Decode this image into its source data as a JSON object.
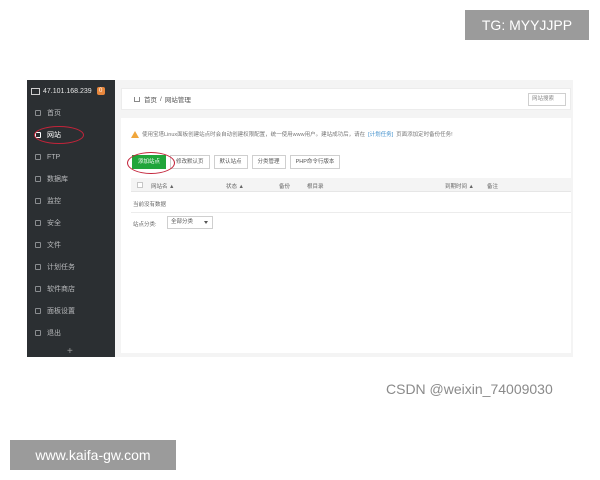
{
  "overlays": {
    "tg": "TG: MYYJJPP",
    "site": "www.kaifa-gw.com",
    "watermark": "CSDN @weixin_74009030"
  },
  "sidebar": {
    "ip": "47.101.168.239",
    "badge": "0",
    "items": [
      {
        "label": "首页",
        "icon": "home-icon"
      },
      {
        "label": "网站",
        "icon": "globe-icon"
      },
      {
        "label": "FTP",
        "icon": "ftp-icon"
      },
      {
        "label": "数据库",
        "icon": "database-icon"
      },
      {
        "label": "监控",
        "icon": "monitor-icon"
      },
      {
        "label": "安全",
        "icon": "shield-icon"
      },
      {
        "label": "文件",
        "icon": "folder-icon"
      },
      {
        "label": "计划任务",
        "icon": "calendar-icon"
      },
      {
        "label": "软件商店",
        "icon": "store-icon"
      },
      {
        "label": "面板设置",
        "icon": "settings-icon"
      },
      {
        "label": "退出",
        "icon": "logout-icon"
      }
    ],
    "plus": "+"
  },
  "breadcrumb": {
    "home": "首页",
    "sep": "/",
    "current": "网站管理"
  },
  "search": {
    "placeholder": "网站搜索"
  },
  "notice": {
    "text_before": "使用宝塔Linux面板创建站点时会自动创建权限配置，统一使用www用户。建站成功后，请在",
    "link": "[计划任务]",
    "text_after": "页面添加定时备份任务!"
  },
  "buttons": {
    "add_site": "添加站点",
    "modify_default": "修改默认页",
    "default_site": "默认站点",
    "category_mgmt": "分类管理",
    "php_cli": "PHP命令行版本"
  },
  "table": {
    "headers": {
      "name": "网站名 ▲",
      "status": "状态 ▲",
      "backup": "备份",
      "root": "根目录",
      "expire": "到期时间 ▲",
      "remark": "备注"
    },
    "empty": "当前没有数据"
  },
  "category": {
    "label": "站点分类:",
    "selected": "全部分类"
  }
}
